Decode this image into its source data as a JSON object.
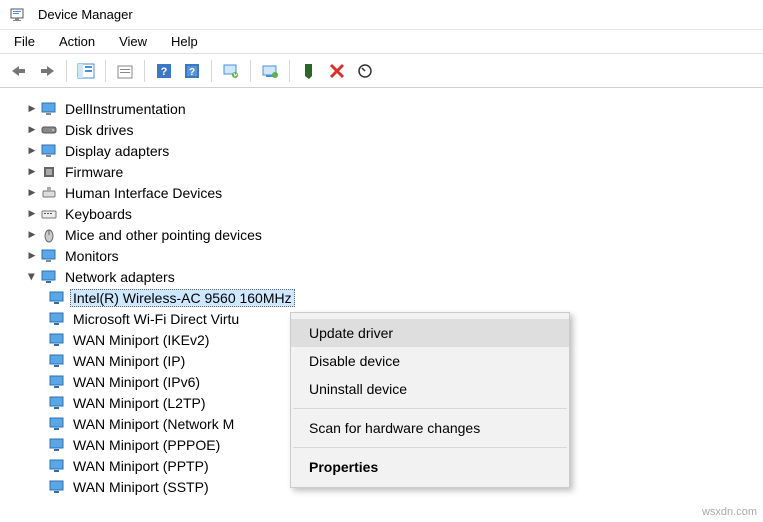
{
  "window": {
    "title": "Device Manager"
  },
  "menu": {
    "file": "File",
    "action": "Action",
    "view": "View",
    "help": "Help"
  },
  "tree": {
    "categories": [
      {
        "name": "DellInstrumentation",
        "icon": "monitor"
      },
      {
        "name": "Disk drives",
        "icon": "disk"
      },
      {
        "name": "Display adapters",
        "icon": "monitor"
      },
      {
        "name": "Firmware",
        "icon": "chip"
      },
      {
        "name": "Human Interface Devices",
        "icon": "hid"
      },
      {
        "name": "Keyboards",
        "icon": "keyboard"
      },
      {
        "name": "Mice and other pointing devices",
        "icon": "mouse"
      },
      {
        "name": "Monitors",
        "icon": "monitor"
      }
    ],
    "network": {
      "label": "Network adapters",
      "children": [
        "Intel(R) Wireless-AC 9560 160MHz",
        "Microsoft Wi-Fi Direct Virtu",
        "WAN Miniport (IKEv2)",
        "WAN Miniport (IP)",
        "WAN Miniport (IPv6)",
        "WAN Miniport (L2TP)",
        "WAN Miniport (Network M",
        "WAN Miniport (PPPOE)",
        "WAN Miniport (PPTP)",
        "WAN Miniport (SSTP)"
      ]
    }
  },
  "context_menu": {
    "update": "Update driver",
    "disable": "Disable device",
    "uninstall": "Uninstall device",
    "scan": "Scan for hardware changes",
    "properties": "Properties"
  },
  "watermark": "wsxdn.com"
}
